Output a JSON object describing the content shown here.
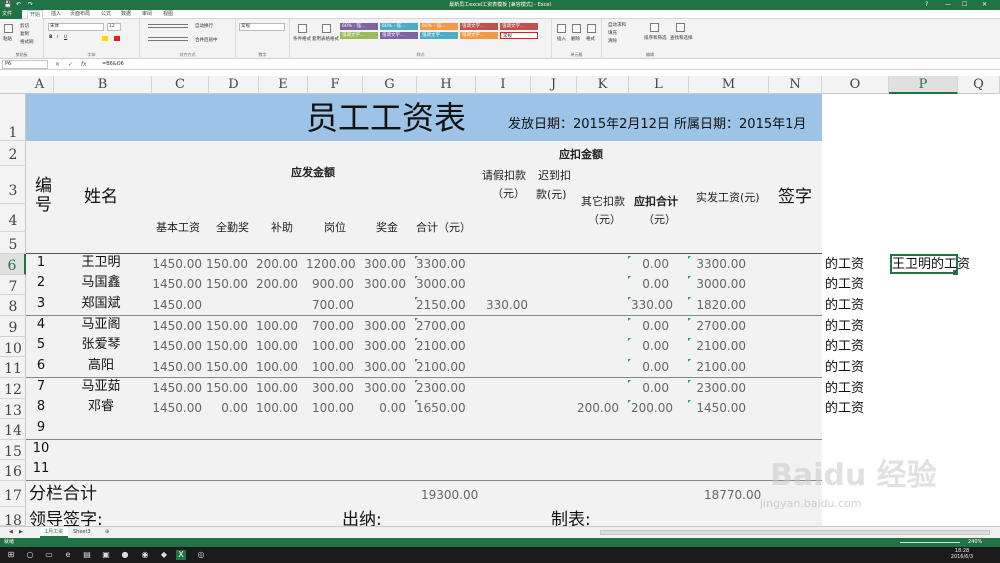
{
  "window": {
    "title": "最新员工excel工资表模板 [兼容模式] - Excel",
    "min": "—",
    "max": "☐",
    "close": "✕",
    "help": "?"
  },
  "quick_access": {
    "save": "💾",
    "undo": "↶",
    "redo": "↷"
  },
  "ribbon_tabs": [
    "文件",
    "开始",
    "插入",
    "页面布局",
    "公式",
    "数据",
    "审阅",
    "视图"
  ],
  "ribbon": {
    "clipboard": {
      "paste": "粘贴",
      "cut": "剪切",
      "copy": "复制",
      "format_painter": "格式刷",
      "label": "剪贴板"
    },
    "font": {
      "font_name": "宋体",
      "font_size": "12",
      "label": "字体",
      "bold": "B",
      "italic": "I",
      "underline": "U"
    },
    "align": {
      "wrap": "自动换行",
      "merge": "合并后居中",
      "label": "对齐方式"
    },
    "number": {
      "format": "常规",
      "label": "数字"
    },
    "styles": {
      "conditional": "条件格式",
      "as_table": "套用表格格式",
      "cell_styles": [
        "60% - 强...",
        "60% - 强...",
        "60% - 强...",
        "强调文字...",
        "强调文字...",
        "强调文字...",
        "强调文字...",
        "强调文字...",
        "强调文字...",
        "常规"
      ],
      "label": "样式"
    },
    "cells": {
      "insert": "插入",
      "delete": "删除",
      "format": "格式",
      "label": "单元格"
    },
    "editing": {
      "autosum": "自动求和",
      "fill": "填充",
      "clear": "清除",
      "sort": "排序和筛选",
      "find": "查找和选择",
      "label": "编辑"
    }
  },
  "formula_bar": {
    "name_box": "P6",
    "cancel": "✕",
    "enter": "✓",
    "fx": "fx",
    "formula": "=B6&O6"
  },
  "colors": {
    "excel_green": "#217346",
    "banner": "#9dc3e6",
    "table_bg": "#f2f2f2",
    "marker": "#2e9a55"
  },
  "columns": [
    "A",
    "B",
    "C",
    "D",
    "E",
    "F",
    "G",
    "H",
    "I",
    "J",
    "K",
    "L",
    "M",
    "N",
    "O",
    "P",
    "Q"
  ],
  "rows": [
    "1",
    "2",
    "3",
    "4",
    "5",
    "6",
    "7",
    "8",
    "9",
    "10",
    "11",
    "12",
    "13",
    "14",
    "15",
    "16",
    "17",
    "18"
  ],
  "selected": {
    "col": "P",
    "row": "6"
  },
  "sheet": {
    "title": "员工工资表",
    "date_line": "发放日期：2015年2月12日 所属日期：2015年1月",
    "headers": {
      "id": "编号",
      "name": "姓名",
      "payable": "应发金额",
      "deduct": "应扣金额",
      "base": "基本工资",
      "attendance": "全勤奖",
      "subsidy": "补助",
      "post": "岗位",
      "bonus": "奖金",
      "total": "合计（元）",
      "leave": "请假扣款（元）",
      "leave_a": "请假扣款",
      "leave_b": "（元）",
      "late": "迟到扣款(元)",
      "late_a": "迟到扣",
      "late_b": "款(元)",
      "other": "其它扣款（元）",
      "other_a": "其它扣款",
      "other_b": "（元）",
      "deduct_total": "应扣合计（元）",
      "deduct_total_a": "应扣合计",
      "deduct_total_b": "（元）",
      "net": "实发工资(元)",
      "sign": "签字"
    },
    "employees": [
      {
        "id": "1",
        "name": "王卫明",
        "base": "1450.00",
        "attendance": "150.00",
        "subsidy": "200.00",
        "post": "1200.00",
        "bonus": "300.00",
        "total": "3300.00",
        "leave": "",
        "late": "",
        "other": "",
        "deduct_total": "0.00",
        "net": "3300.00",
        "side": "的工资",
        "concat": "王卫明的工资"
      },
      {
        "id": "2",
        "name": "马国鑫",
        "base": "1450.00",
        "attendance": "150.00",
        "subsidy": "200.00",
        "post": "900.00",
        "bonus": "300.00",
        "total": "3000.00",
        "leave": "",
        "late": "",
        "other": "",
        "deduct_total": "0.00",
        "net": "3000.00",
        "side": "的工资",
        "concat": ""
      },
      {
        "id": "3",
        "name": "郑国斌",
        "base": "1450.00",
        "attendance": "",
        "subsidy": "",
        "post": "700.00",
        "bonus": "",
        "total": "2150.00",
        "leave": "330.00",
        "late": "",
        "other": "",
        "deduct_total": "330.00",
        "net": "1820.00",
        "side": "的工资",
        "concat": ""
      },
      {
        "id": "4",
        "name": "马亚阁",
        "base": "1450.00",
        "attendance": "150.00",
        "subsidy": "100.00",
        "post": "700.00",
        "bonus": "300.00",
        "total": "2700.00",
        "leave": "",
        "late": "",
        "other": "",
        "deduct_total": "0.00",
        "net": "2700.00",
        "side": "的工资",
        "concat": ""
      },
      {
        "id": "5",
        "name": "张爱琴",
        "base": "1450.00",
        "attendance": "150.00",
        "subsidy": "100.00",
        "post": "100.00",
        "bonus": "300.00",
        "total": "2100.00",
        "leave": "",
        "late": "",
        "other": "",
        "deduct_total": "0.00",
        "net": "2100.00",
        "side": "的工资",
        "concat": ""
      },
      {
        "id": "6",
        "name": "高阳",
        "base": "1450.00",
        "attendance": "150.00",
        "subsidy": "100.00",
        "post": "100.00",
        "bonus": "300.00",
        "total": "2100.00",
        "leave": "",
        "late": "",
        "other": "",
        "deduct_total": "0.00",
        "net": "2100.00",
        "side": "的工资",
        "concat": ""
      },
      {
        "id": "7",
        "name": "马亚茹",
        "base": "1450.00",
        "attendance": "150.00",
        "subsidy": "100.00",
        "post": "300.00",
        "bonus": "300.00",
        "total": "2300.00",
        "leave": "",
        "late": "",
        "other": "",
        "deduct_total": "0.00",
        "net": "2300.00",
        "side": "的工资",
        "concat": ""
      },
      {
        "id": "8",
        "name": "邓睿",
        "base": "1450.00",
        "attendance": "0.00",
        "subsidy": "100.00",
        "post": "100.00",
        "bonus": "0.00",
        "total": "1650.00",
        "leave": "",
        "late": "",
        "other": "200.00",
        "deduct_total": "200.00",
        "net": "1450.00",
        "side": "的工资",
        "concat": ""
      }
    ],
    "empty_ids": [
      "9",
      "10",
      "11"
    ],
    "subtotal": {
      "label": "分栏合计",
      "total": "19300.00",
      "net": "18770.00"
    },
    "footer": {
      "leader": "领导签字:",
      "cashier": "出纳:",
      "maker": "制表:"
    }
  },
  "sheet_tabs": {
    "tabs": [
      "1月工资",
      "Sheet3"
    ],
    "add": "⊕",
    "nav_prev": "◀",
    "nav_next": "▶"
  },
  "status": {
    "ready": "就绪",
    "zoom": "240%"
  },
  "watermark": {
    "brand": "Baidu 经验",
    "url": "jingyan.baidu.com"
  },
  "taskbar": {
    "time": "18:28",
    "date": "2016/6/3"
  }
}
